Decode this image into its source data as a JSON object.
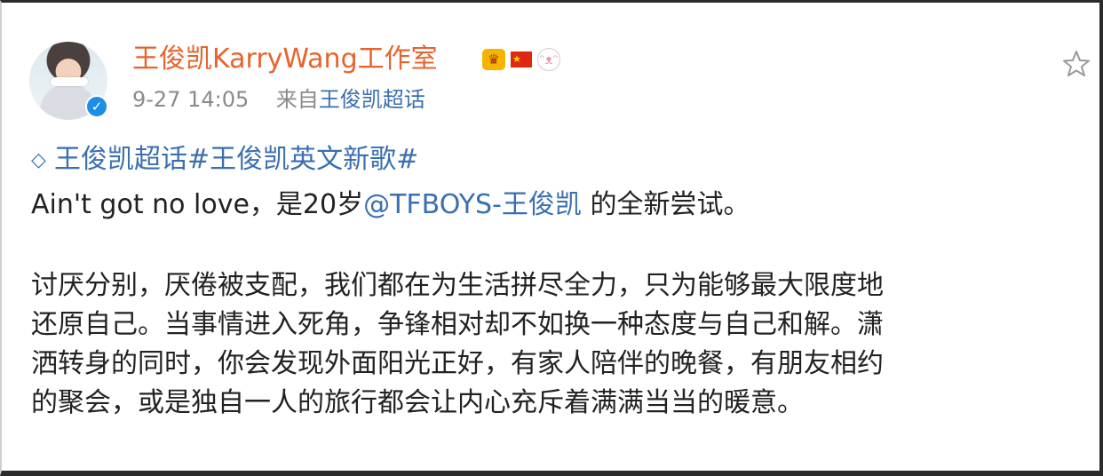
{
  "post": {
    "author_name": "王俊凯KarryWang工作室",
    "badges": [
      "crown-badge",
      "china-flag-badge",
      "bunny-badge"
    ],
    "time": "9-27 14:05",
    "source_prefix": "来自",
    "source_name": "王俊凯超话",
    "topics": "王俊凯超话#王俊凯英文新歌#",
    "line2_before": "Ain't got no love，是20岁",
    "mention": "@TFBOYS-王俊凯",
    "line2_after": " 的全新尝试。",
    "paragraph_lines": [
      "讨厌分别，厌倦被支配，我们都在为生活拼尽全力，只为能够最大限度地",
      "还原自己。当事情进入死角，争锋相对却不如换一种态度与自己和解。潇",
      "洒转身的同时，你会发现外面阳光正好，有家人陪伴的晚餐，有朋友相约",
      "的聚会，或是独自一人的旅行都会让内心充斥着满满当当的暖意。"
    ]
  },
  "colors": {
    "name": "#e8632b",
    "link": "#3a6fb0",
    "meta": "#8a8a8a",
    "text": "#222222",
    "verified": "#1b8fe6"
  }
}
